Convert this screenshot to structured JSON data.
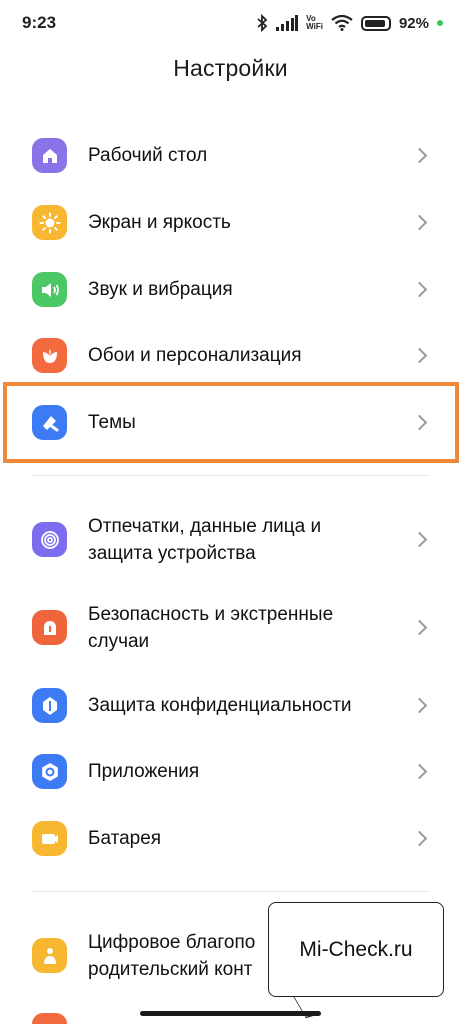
{
  "status_bar": {
    "time": "9:23",
    "vowifi_top": "Vo",
    "vowifi_bottom": "WiFi",
    "battery_percent": "92",
    "battery_level": 0.92,
    "charge_color": "#3cc45a"
  },
  "page": {
    "title": "Настройки"
  },
  "sections": {
    "group1": [
      {
        "label": "Рабочий стол",
        "icon": "home-icon",
        "color": "#8a73e8"
      },
      {
        "label": "Экран и яркость",
        "icon": "sun-icon",
        "color": "#f7b731"
      },
      {
        "label": "Звук и вибрация",
        "icon": "speaker-icon",
        "color": "#4cc766"
      },
      {
        "label": "Обои и персонализация",
        "icon": "flower-icon",
        "color": "#f26a3d"
      },
      {
        "label": "Темы",
        "icon": "theme-brush-icon",
        "color": "#3d7bf4"
      }
    ],
    "group2": [
      {
        "label_line1": "Отпечатки, данные лица и",
        "label_line2": "защита устройства",
        "icon": "fingerprint-icon",
        "color": "#7b6cf0"
      },
      {
        "label_line1": "Безопасность и экстренные",
        "label_line2": "случаи",
        "icon": "emergency-icon",
        "color": "#f0643c"
      },
      {
        "label": "Защита конфиденциальности",
        "icon": "privacy-icon",
        "color": "#3d7bf4"
      },
      {
        "label": "Приложения",
        "icon": "apps-gear-icon",
        "color": "#3d7bf4"
      },
      {
        "label": "Батарея",
        "icon": "battery-icon",
        "color": "#f7b731"
      }
    ],
    "group3": [
      {
        "label_line1": "Цифровое благопо",
        "label_line2": "родительский конт",
        "icon": "wellbeing-icon",
        "color": "#f7b731"
      }
    ]
  },
  "watermark": {
    "text": "Mi-Check.ru"
  },
  "colors": {
    "highlight": "#f0883a",
    "chevron": "#9a9a9a"
  }
}
